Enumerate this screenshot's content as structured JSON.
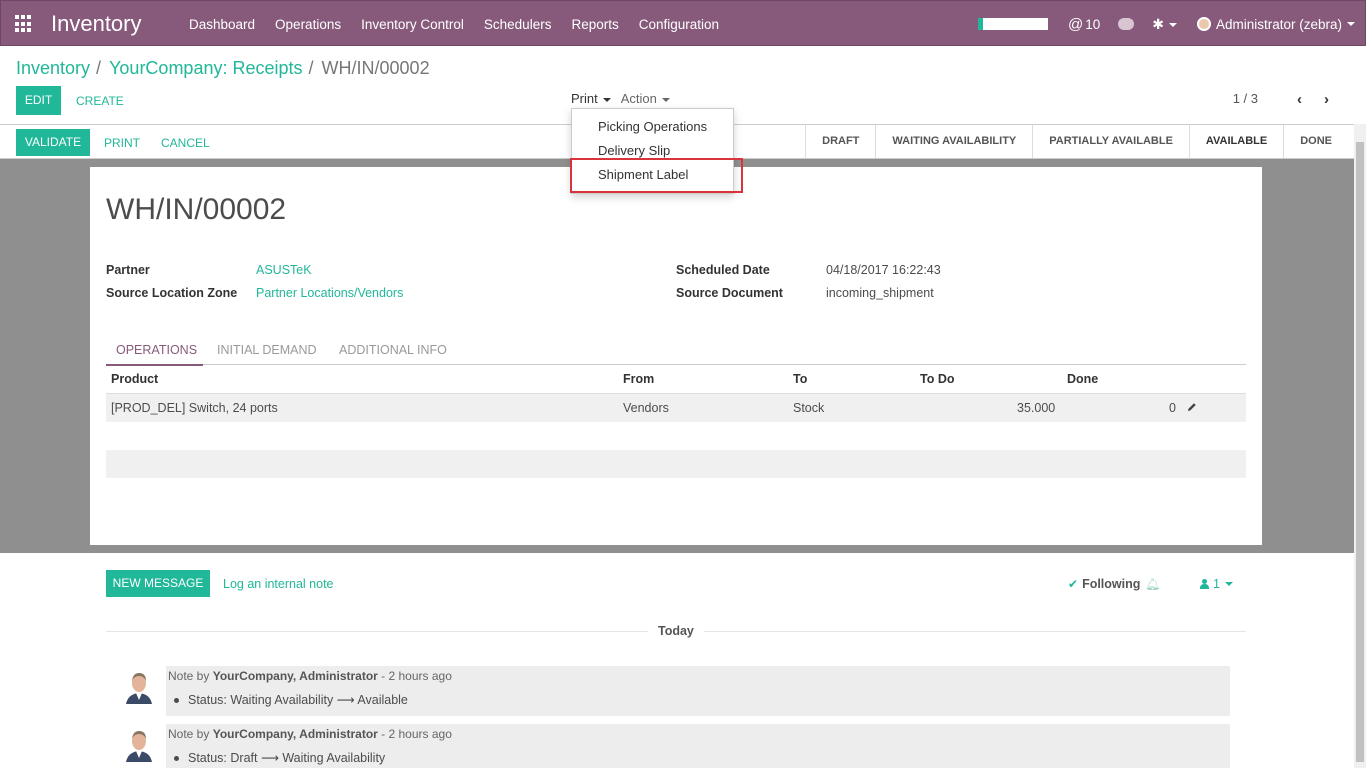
{
  "navbar": {
    "brand": "Inventory",
    "menu": [
      "Dashboard",
      "Operations",
      "Inventory Control",
      "Schedulers",
      "Reports",
      "Configuration"
    ],
    "mentions_count": "10",
    "user": "Administrator (zebra)",
    "progress_fraction": 0.07,
    "bg_color": "#875a7b"
  },
  "breadcrumb": {
    "items": [
      "Inventory",
      "YourCompany: Receipts"
    ],
    "current": "WH/IN/00002"
  },
  "buttons": {
    "edit": "EDIT",
    "create": "CREATE",
    "print_menu": "Print",
    "action_menu": "Action",
    "validate": "VALIDATE",
    "print": "PRINT",
    "cancel": "CANCEL",
    "new_message": "NEW MESSAGE",
    "log_note": "Log an internal note"
  },
  "pager": {
    "value": "1 / 3"
  },
  "print_dropdown": {
    "items": [
      "Picking Operations",
      "Delivery Slip",
      "Shipment Label"
    ],
    "highlighted": "Shipment Label"
  },
  "stages": [
    "DRAFT",
    "WAITING AVAILABILITY",
    "PARTIALLY AVAILABLE",
    "AVAILABLE",
    "DONE"
  ],
  "record": {
    "title": "WH/IN/00002",
    "partner_label": "Partner",
    "partner": "ASUSTeK",
    "source_zone_label": "Source Location Zone",
    "source_zone": "Partner Locations/Vendors",
    "scheduled_label": "Scheduled Date",
    "scheduled": "04/18/2017 16:22:43",
    "source_doc_label": "Source Document",
    "source_doc": "incoming_shipment"
  },
  "tabs": [
    "OPERATIONS",
    "INITIAL DEMAND",
    "ADDITIONAL INFO"
  ],
  "table": {
    "headers": [
      "Product",
      "From",
      "To",
      "To Do",
      "Done"
    ],
    "rows": [
      {
        "product": "[PROD_DEL] Switch, 24 ports",
        "from": "Vendors",
        "to": "Stock",
        "todo": "35.000",
        "done": "0"
      }
    ]
  },
  "chatter": {
    "following": "Following",
    "followers_count": "1",
    "today": "Today",
    "messages": [
      {
        "prefix": "Note by",
        "author": "YourCompany, Administrator",
        "time": "- 2 hours ago",
        "status": "Status: Waiting Availability ⟶ Available"
      },
      {
        "prefix": "Note by",
        "author": "YourCompany, Administrator",
        "time": "- 2 hours ago",
        "status": "Status: Draft ⟶ Waiting Availability"
      }
    ]
  }
}
